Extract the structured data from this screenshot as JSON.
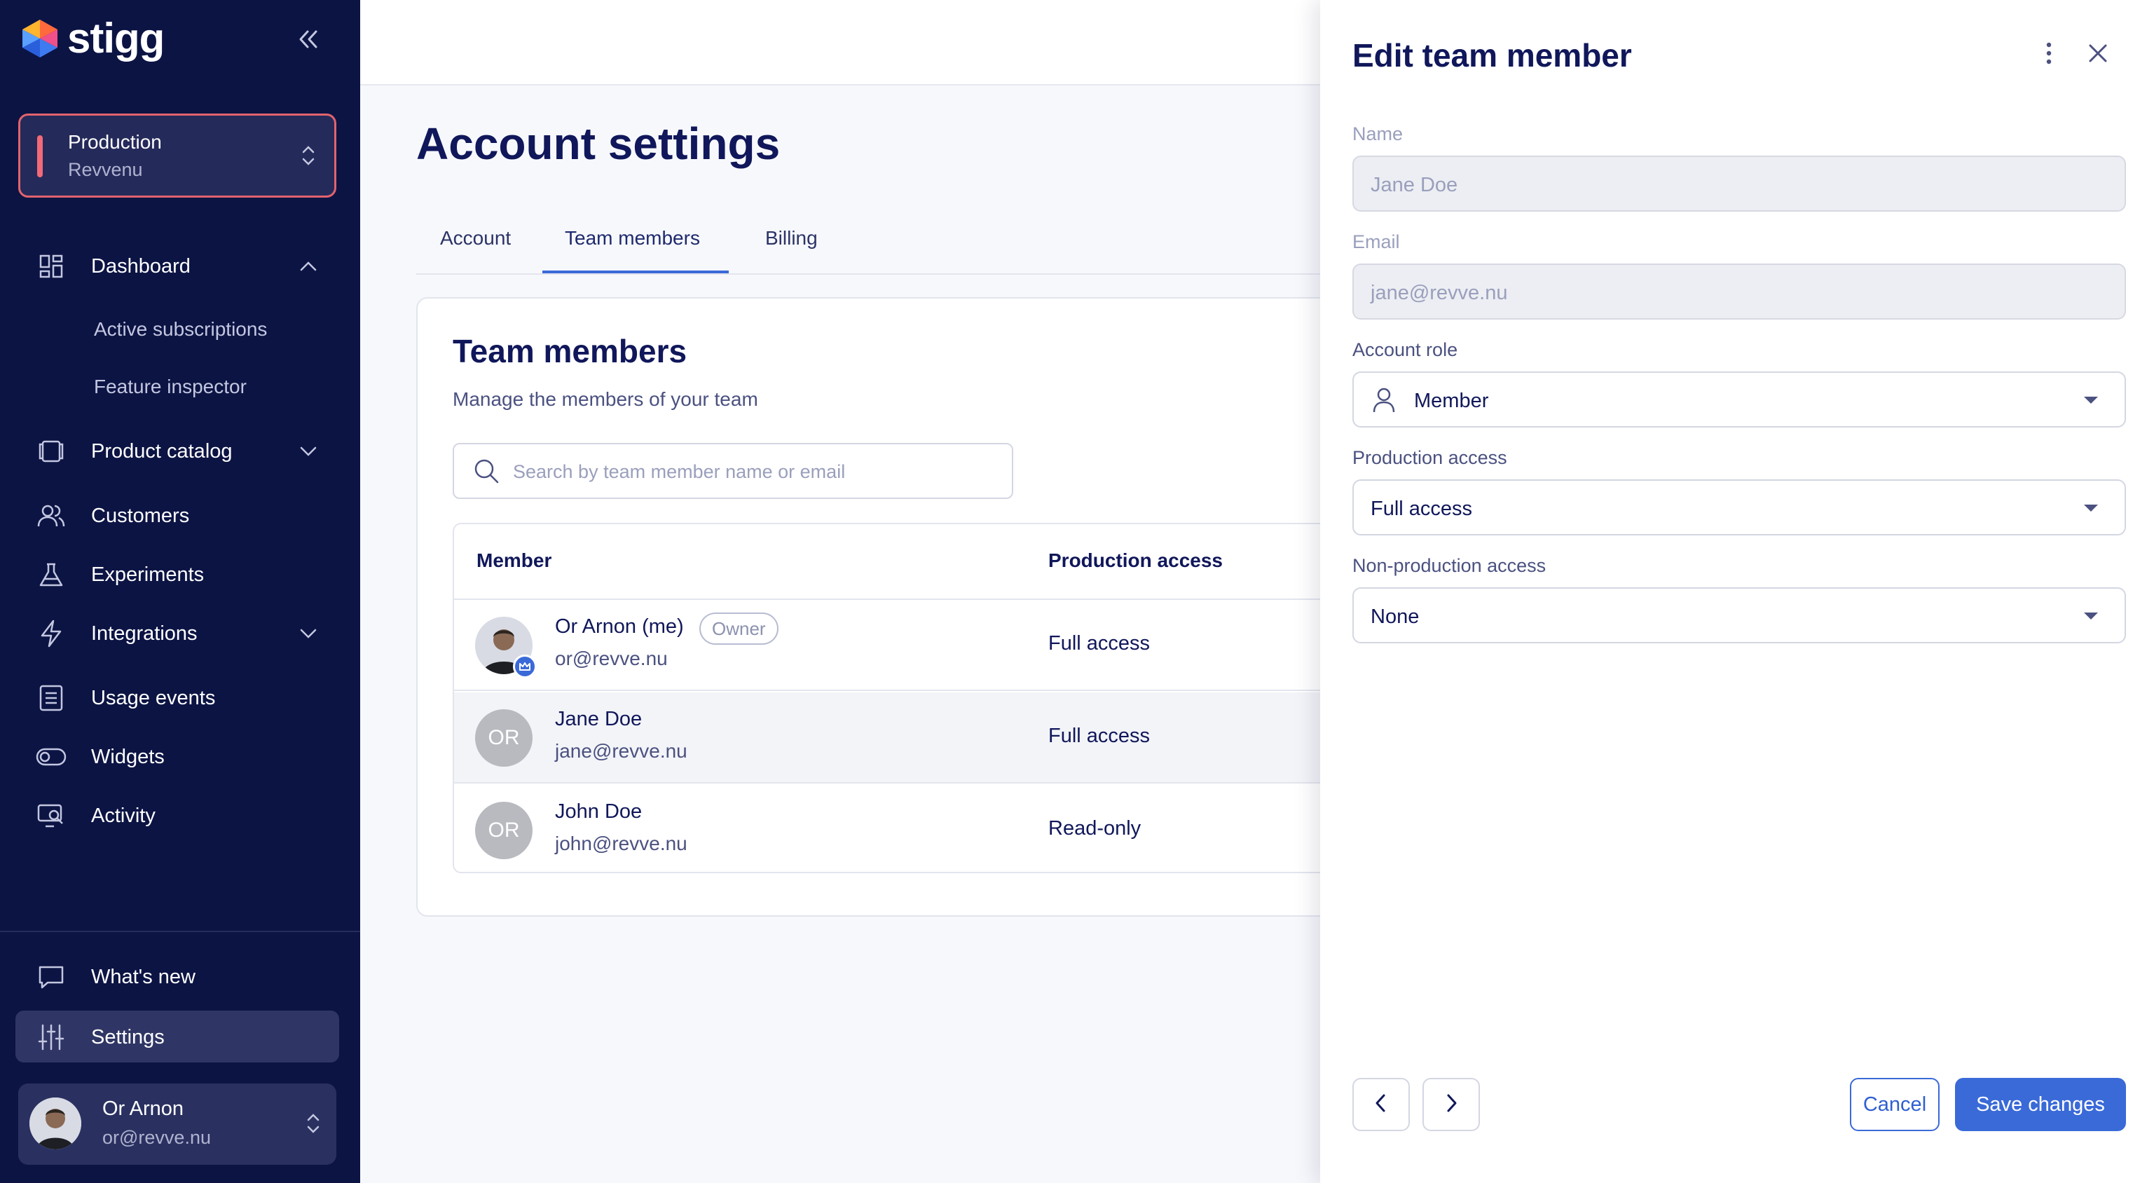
{
  "app": {
    "logo_text": "stigg"
  },
  "environment": {
    "name": "Production",
    "account": "Revvenu"
  },
  "sidebar": {
    "items": [
      {
        "label": "Dashboard"
      },
      {
        "label": "Active subscriptions"
      },
      {
        "label": "Feature inspector"
      },
      {
        "label": "Product catalog"
      },
      {
        "label": "Customers"
      },
      {
        "label": "Experiments"
      },
      {
        "label": "Integrations"
      },
      {
        "label": "Usage events"
      },
      {
        "label": "Widgets"
      },
      {
        "label": "Activity"
      }
    ],
    "bottom": [
      {
        "label": "What's new"
      },
      {
        "label": "Settings"
      }
    ],
    "user": {
      "name": "Or Arnon",
      "email": "or@revve.nu"
    }
  },
  "page": {
    "title": "Account settings",
    "tabs": [
      {
        "label": "Account"
      },
      {
        "label": "Team members"
      },
      {
        "label": "Billing"
      }
    ],
    "active_tab": "Team members"
  },
  "team": {
    "title": "Team members",
    "subtitle": "Manage the members of your team",
    "search_placeholder": "Search by team member name or email",
    "columns": [
      "Member",
      "Production access"
    ],
    "members": [
      {
        "name": "Or Arnon (me)",
        "email": "or@revve.nu",
        "badge": "Owner",
        "production_access": "Full access"
      },
      {
        "name": "Jane Doe",
        "email": "jane@revve.nu",
        "initials": "OR",
        "production_access": "Full access"
      },
      {
        "name": "John Doe",
        "email": "john@revve.nu",
        "initials": "OR",
        "production_access": "Read-only"
      }
    ]
  },
  "drawer": {
    "title": "Edit team member",
    "fields": {
      "name": {
        "label": "Name",
        "value": "Jane Doe"
      },
      "email": {
        "label": "Email",
        "value": "jane@revve.nu"
      },
      "account_role": {
        "label": "Account role",
        "value": "Member"
      },
      "production_access": {
        "label": "Production access",
        "value": "Full access"
      },
      "non_production_access": {
        "label": "Non-production access",
        "value": "None"
      }
    },
    "cancel_label": "Cancel",
    "save_label": "Save changes"
  },
  "colors": {
    "sidebar_bg": "#0c1444",
    "accent": "#3a6ad8",
    "env_border": "#e2636e",
    "text_primary": "#10175a"
  }
}
